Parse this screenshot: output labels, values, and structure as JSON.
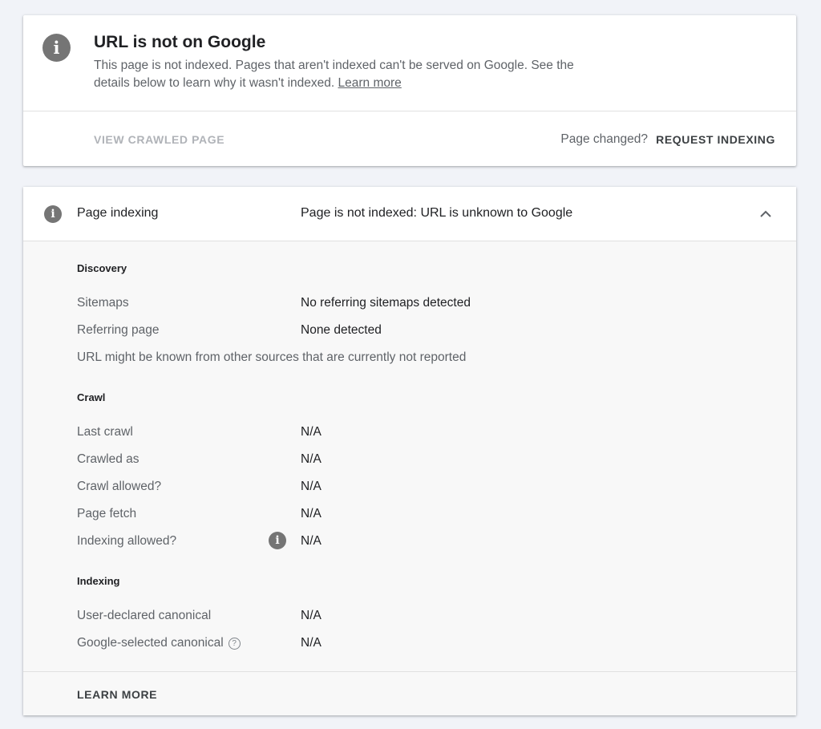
{
  "status_card": {
    "icon": "info-icon",
    "title": "URL is not on Google",
    "description": "This page is not indexed. Pages that aren't indexed can't be served on Google. See the details below to learn why it wasn't indexed.",
    "learn_more": "Learn more",
    "view_crawled_page": "VIEW CRAWLED PAGE",
    "page_changed": "Page changed?",
    "request_indexing": "REQUEST INDEXING"
  },
  "indexing_card": {
    "icon": "info-icon",
    "title": "Page indexing",
    "status": "Page is not indexed: URL is unknown to Google",
    "collapse_icon": "chevron-up-icon",
    "discovery": {
      "heading": "Discovery",
      "sitemaps_label": "Sitemaps",
      "sitemaps_value": "No referring sitemaps detected",
      "referring_label": "Referring page",
      "referring_value": "None detected",
      "note": "URL might be known from other sources that are currently not reported"
    },
    "crawl": {
      "heading": "Crawl",
      "rows": [
        {
          "label": "Last crawl",
          "value": "N/A"
        },
        {
          "label": "Crawled as",
          "value": "N/A"
        },
        {
          "label": "Crawl allowed?",
          "value": "N/A"
        },
        {
          "label": "Page fetch",
          "value": "N/A"
        },
        {
          "label": "Indexing allowed?",
          "value": "N/A"
        }
      ]
    },
    "indexing": {
      "heading": "Indexing",
      "rows": [
        {
          "label": "User-declared canonical",
          "value": "N/A"
        },
        {
          "label": "Google-selected canonical",
          "value": "N/A"
        }
      ]
    },
    "learn_more": "LEARN MORE"
  },
  "colors": {
    "background": "#f1f3f8",
    "card": "#ffffff",
    "section_bg": "#f8f8f8",
    "icon_gray": "#757575",
    "muted_text": "#5f6368",
    "disabled_text": "#b0b3b8"
  }
}
